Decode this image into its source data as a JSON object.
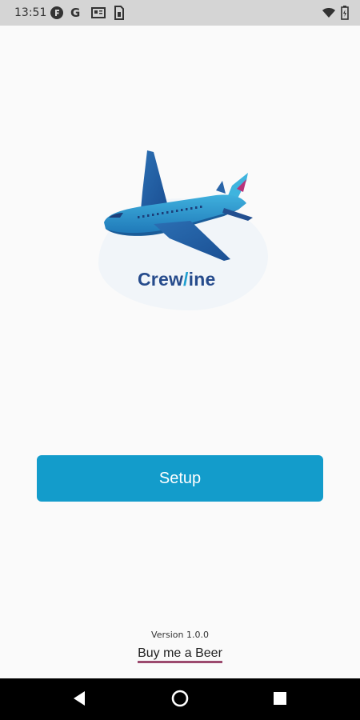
{
  "status_bar": {
    "time": "13:51",
    "left_icons": [
      "notification-f-icon",
      "google-icon",
      "news-icon",
      "sim-icon"
    ],
    "right_icons": [
      "wifi-icon",
      "battery-icon"
    ],
    "google_glyph": "G"
  },
  "brand": {
    "name_part1": "Crew",
    "name_slash": "/",
    "name_part2": "ine"
  },
  "main": {
    "setup_label": "Setup"
  },
  "footer": {
    "version": "Version 1.0.0",
    "beer_link": "Buy me a Beer"
  },
  "nav": {
    "buttons": [
      "back",
      "home",
      "recents"
    ]
  },
  "colors": {
    "accent": "#139ccb",
    "brand_dark": "#264b8c",
    "link_underline": "#9c4a6e",
    "background": "#fafafa"
  }
}
